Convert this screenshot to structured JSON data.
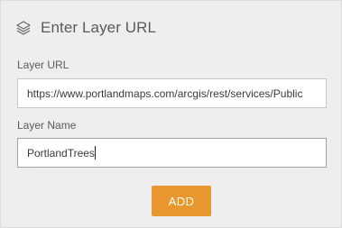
{
  "header": {
    "icon": "layers-icon",
    "title": "Enter Layer URL"
  },
  "layer_url": {
    "label": "Layer URL",
    "value": "https://www.portlandmaps.com/arcgis/rest/services/Public"
  },
  "layer_name": {
    "label": "Layer Name",
    "value": "PortlandTrees"
  },
  "actions": {
    "add_label": "ADD"
  },
  "colors": {
    "accent": "#e8962e",
    "panel_bg": "#eeeeee",
    "text": "#5a5a5a"
  }
}
